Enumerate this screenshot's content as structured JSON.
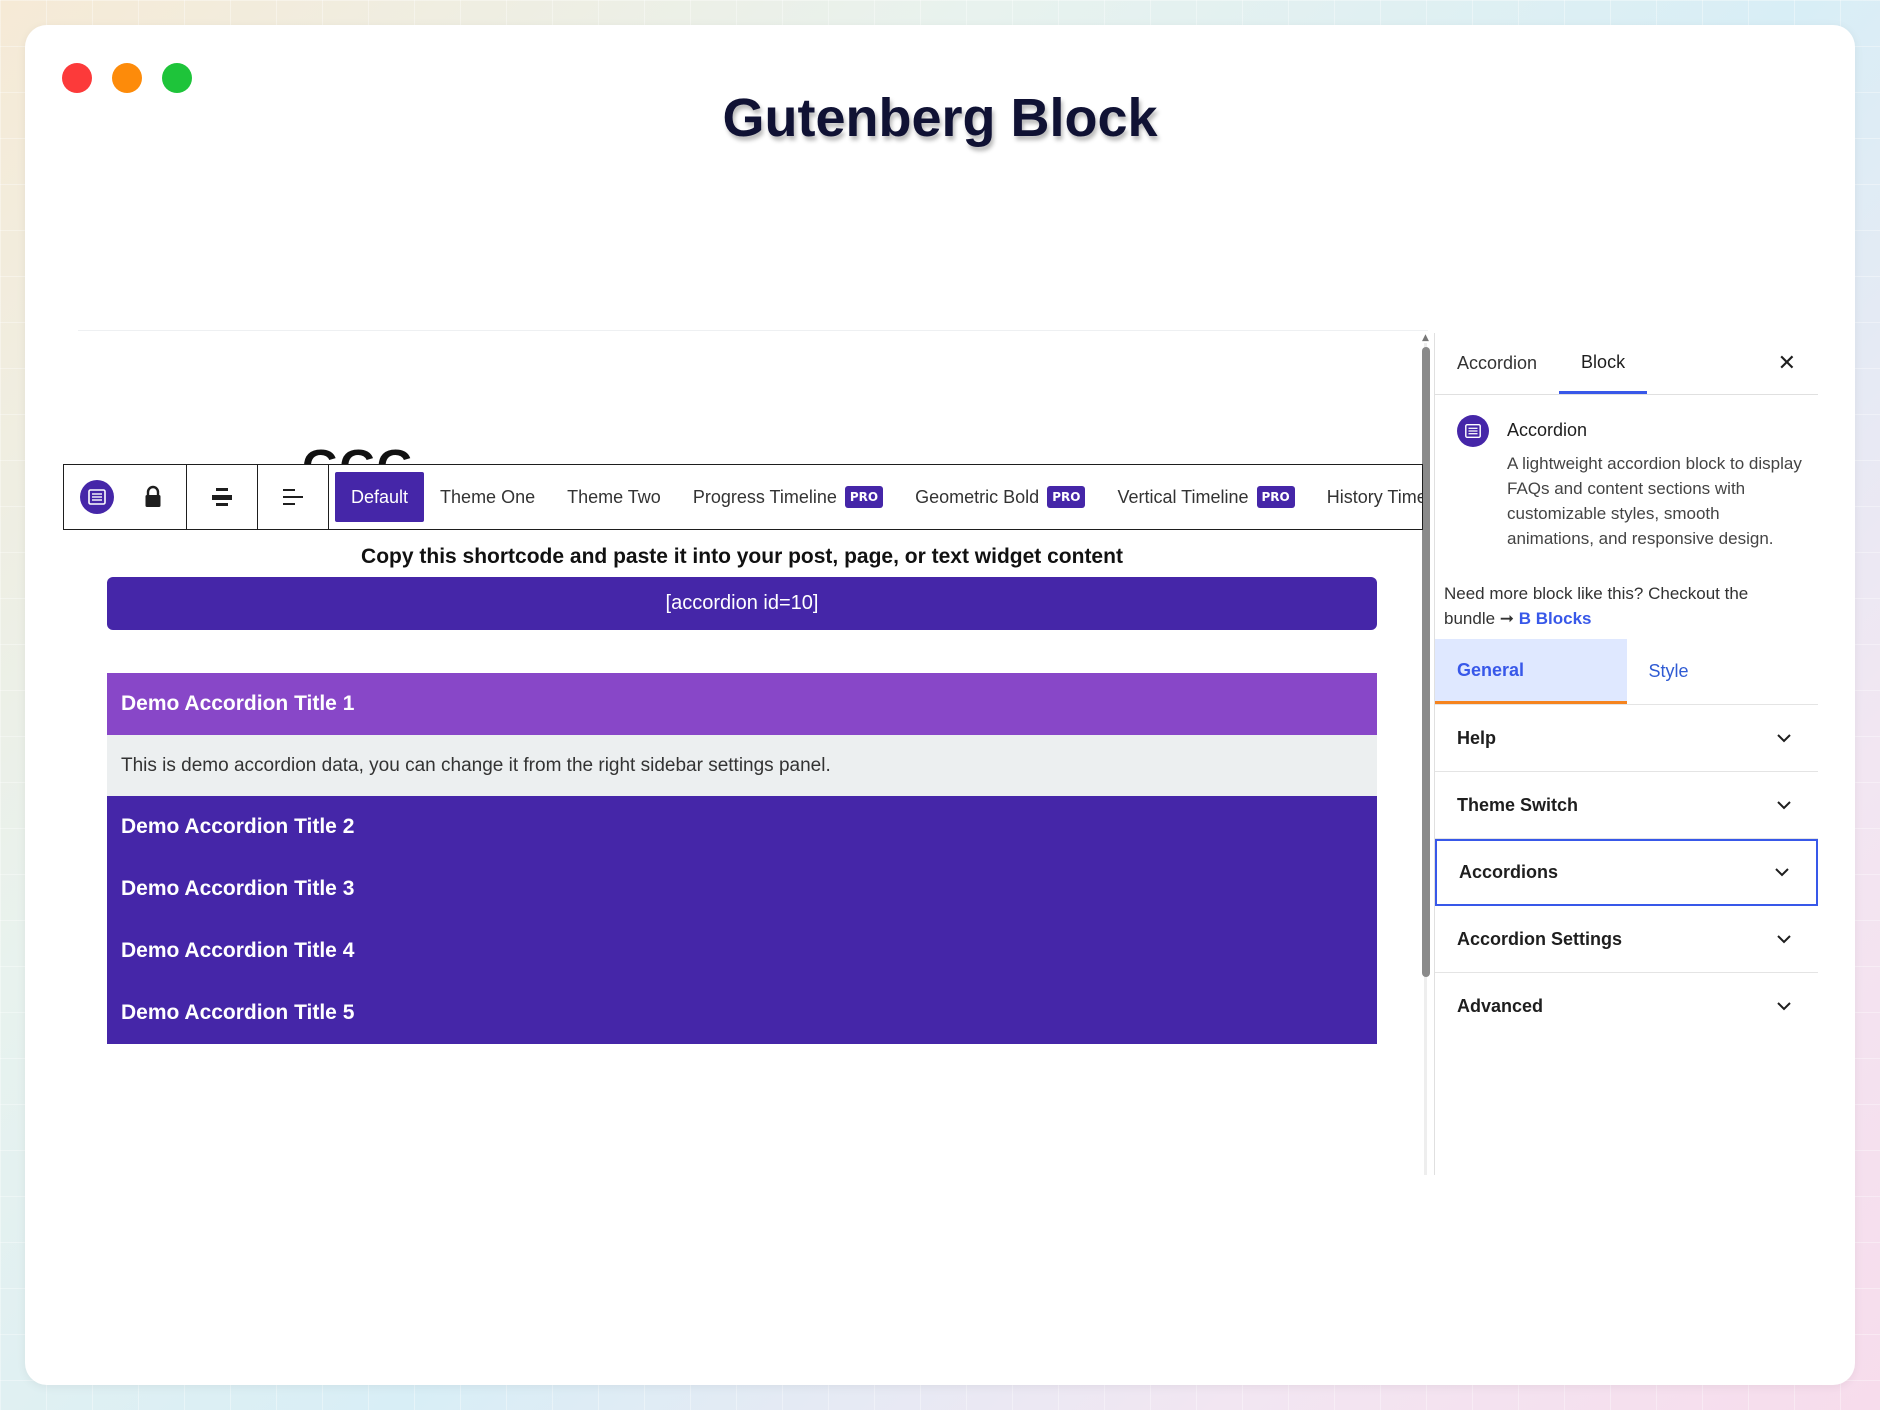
{
  "window": {
    "title": "Gutenberg Block",
    "colors": {
      "close": "#fc3a3a",
      "minimize": "#fd8b0a",
      "maximize": "#1ec43a",
      "accent": "#4526a8",
      "accent_open": "#8847c8",
      "link": "#3858e9"
    }
  },
  "canvas": {
    "partial_heading": "GGG"
  },
  "toolbar": {
    "themes": [
      {
        "label": "Default",
        "pro": ""
      },
      {
        "label": "Theme One",
        "pro": ""
      },
      {
        "label": "Theme Two",
        "pro": ""
      },
      {
        "label": "Progress Timeline",
        "pro": "PRO"
      },
      {
        "label": "Geometric Bold",
        "pro": "PRO"
      },
      {
        "label": "Vertical Timeline",
        "pro": "PRO"
      },
      {
        "label": "History Timeline",
        "pro": ""
      }
    ],
    "icons": [
      "accordion-block-icon",
      "lock-icon",
      "align-center-icon",
      "align-left-icon"
    ]
  },
  "shortcode": {
    "label": "Copy this shortcode and paste it into your post, page, or text widget content",
    "value": "[accordion id=10]"
  },
  "accordion": {
    "items": [
      {
        "title": "Demo Accordion Title 1",
        "body": "This is demo accordion data, you can change it from the right sidebar settings panel."
      },
      {
        "title": "Demo Accordion Title 2"
      },
      {
        "title": "Demo Accordion Title 3"
      },
      {
        "title": "Demo Accordion Title 4"
      },
      {
        "title": "Demo Accordion Title 5"
      }
    ]
  },
  "sidebar": {
    "tabs": [
      "Accordion",
      "Block"
    ],
    "close_label": "✕",
    "block_name": "Accordion",
    "block_description": "A lightweight accordion block to display FAQs and content sections with customizable styles, smooth animations, and responsive design.",
    "promo_text": "Need more block like this? Checkout the bundle ➞ ",
    "promo_link": "B Blocks",
    "settings_tabs": [
      "General",
      "Style"
    ],
    "panels": [
      "Help",
      "Theme Switch",
      "Accordions",
      "Accordion Settings",
      "Advanced"
    ]
  }
}
